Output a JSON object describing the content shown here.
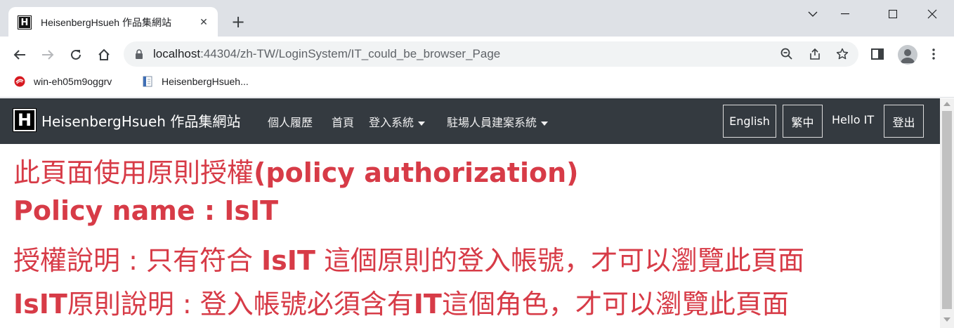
{
  "browser": {
    "tab_title": "HeisenbergHsueh 作品集網站",
    "favicon_letter": "H",
    "url_host": "localhost",
    "url_rest": ":44304/zh-TW/LoginSystem/IT_could_be_browser_Page",
    "bookmarks": [
      {
        "label": "win-eh05m9oggrv",
        "icon": "trend-micro-icon"
      },
      {
        "label": "HeisenbergHsueh...",
        "icon": "page-icon"
      }
    ]
  },
  "site": {
    "brand_letter": "H",
    "brand": "HeisenbergHsueh 作品集網站",
    "nav": {
      "resume": "個人履歷",
      "home": "首頁",
      "login_system": "登入系統",
      "onsite_system": "駐場人員建案系統"
    },
    "lang_en": "English",
    "lang_zh": "繁中",
    "greeting": "Hello IT",
    "logout": "登出"
  },
  "content": {
    "line1_a": "此頁面使用原則授權",
    "line1_b": "(policy authorization)",
    "line2": "Policy name : IsIT",
    "line3_a": "授權說明 : 只有符合 ",
    "line3_b": "IsIT",
    "line3_c": " 這個原則的登入帳號，才可以瀏覽此頁面",
    "line4_a": "IsIT",
    "line4_b": "原則說明 : 登入帳號必須含有",
    "line4_c": "IT",
    "line4_d": "這個角色，才可以瀏覽此頁面"
  },
  "colors": {
    "navbar": "#343a40",
    "content_text": "#d73b47"
  }
}
